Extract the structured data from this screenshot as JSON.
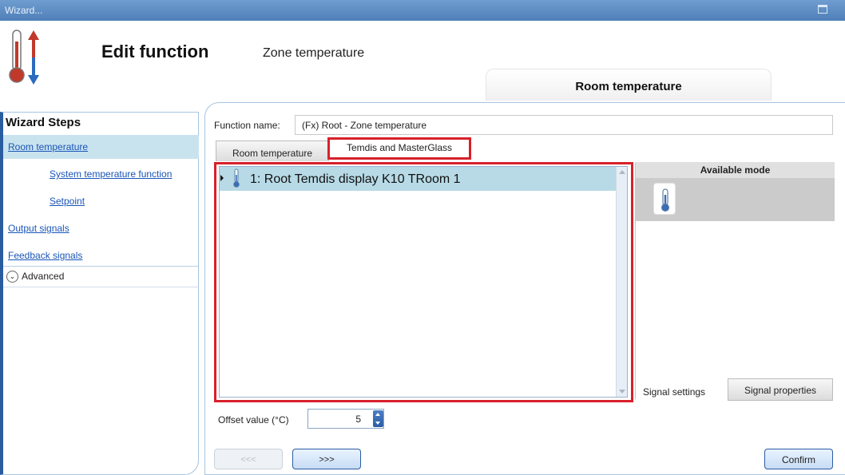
{
  "window": {
    "title": "Wizard...",
    "maximize_icon": "maximize-icon"
  },
  "header": {
    "icon": "thermometer-updown-icon",
    "title": "Edit function",
    "subtitle": "Zone temperature",
    "tab_label": "Room temperature"
  },
  "sidebar": {
    "title": "Wizard Steps",
    "items": [
      {
        "label": "Room temperature",
        "selected": true,
        "indent": false
      },
      {
        "label": "System temperature function",
        "selected": false,
        "indent": true
      },
      {
        "label": "Setpoint",
        "selected": false,
        "indent": true
      },
      {
        "label": "Output signals",
        "selected": false,
        "indent": false
      },
      {
        "label": "Feedback signals",
        "selected": false,
        "indent": false
      }
    ],
    "advanced_label": "Advanced",
    "advanced_icon": "chevron-down-circle-icon"
  },
  "main": {
    "function_name_label": "Function name:",
    "function_name_value": "(Fx) Root - Zone temperature",
    "tabs": [
      {
        "label": "Room temperature",
        "active": false
      },
      {
        "label": "Temdis and MasterGlass",
        "active": true
      }
    ],
    "list_items": [
      {
        "label": "1: Root Temdis display K10 TRoom 1",
        "selected": true,
        "icon": "thermometer-icon"
      }
    ],
    "available_mode_header": "Available mode",
    "available_mode_icon": "thermometer-icon",
    "signal_tabs": [
      {
        "label": "Signal settings",
        "active": true
      },
      {
        "label": "Signal properties",
        "active": false
      }
    ],
    "offset_label": "Offset value (°C)",
    "offset_value": "5"
  },
  "footer": {
    "prev_label": "<<<",
    "next_label": ">>>",
    "confirm_label": "Confirm"
  },
  "colors": {
    "accent": "#2a5da0",
    "highlight_frame": "#d8202a",
    "selected_row": "#b7dae6"
  }
}
